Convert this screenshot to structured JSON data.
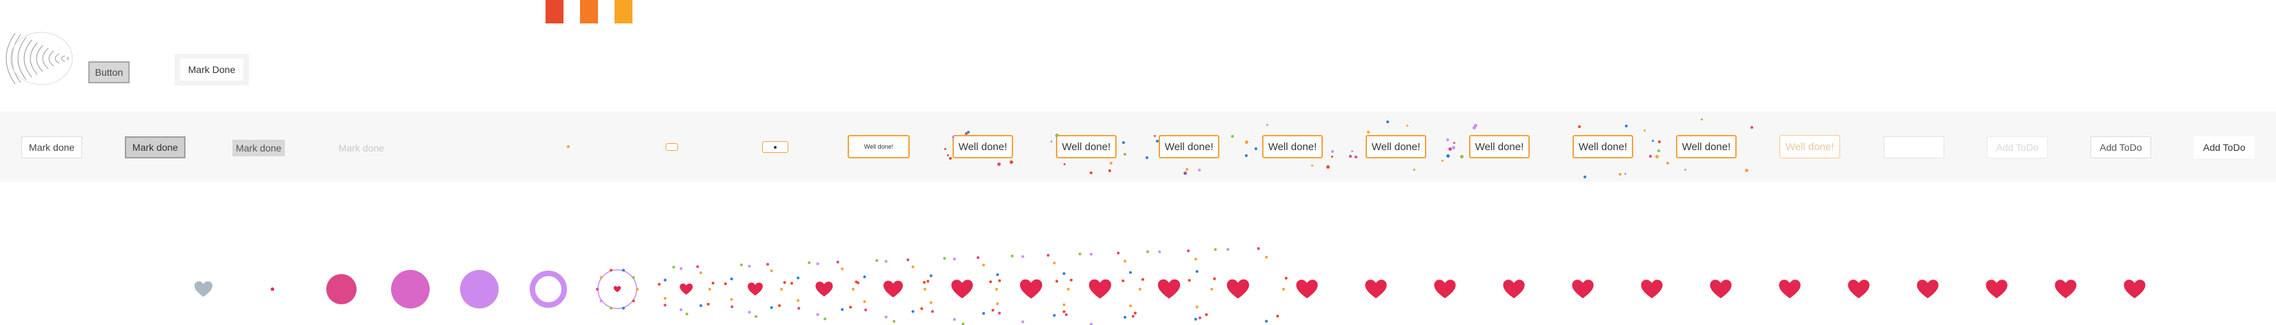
{
  "colors": {
    "swatches": [
      "#e64a2b",
      "#f47a24",
      "#f8a526"
    ],
    "heart_red": "#e2264d",
    "heart_grey": "#aab8c2",
    "circle_pink": "#dd4688",
    "circle_magenta": "#d867c8",
    "circle_violet": "#cd8aee",
    "ring_violet": "#cc8ef5",
    "orange_border": "#f3a33a"
  },
  "top": {
    "button_label": "Button",
    "mark_done_label": "Mark Done"
  },
  "band": {
    "chips": [
      {
        "label": "Mark done",
        "style": "plain"
      },
      {
        "label": "Mark done",
        "style": "pressed"
      },
      {
        "label": "Mark done",
        "style": "grey"
      },
      {
        "label": "Mark done",
        "style": "ghost"
      },
      {
        "label": "",
        "style": "dot"
      },
      {
        "label": "",
        "style": "tiny"
      },
      {
        "label": "",
        "style": "small"
      },
      {
        "label": "Well done!",
        "style": "orange-small"
      },
      {
        "label": "Well done!",
        "style": "orange"
      },
      {
        "label": "Well done!",
        "style": "orange"
      },
      {
        "label": "Well done!",
        "style": "orange"
      },
      {
        "label": "Well done!",
        "style": "orange"
      },
      {
        "label": "Well done!",
        "style": "orange"
      },
      {
        "label": "Well done!",
        "style": "orange"
      },
      {
        "label": "Well done!",
        "style": "orange"
      },
      {
        "label": "Well done!",
        "style": "orange"
      },
      {
        "label": "Well done!",
        "style": "orange-faded"
      },
      {
        "label": "",
        "style": "empty"
      },
      {
        "label": "Add ToDo",
        "style": "addfaint"
      },
      {
        "label": "Add ToDo",
        "style": "add"
      },
      {
        "label": "Add ToDo",
        "style": "addbold"
      }
    ]
  },
  "hearts": {
    "frames": [
      "grey-heart",
      "red-dot",
      "pink-circle",
      "magenta-circle",
      "violet-circle",
      "violet-ring",
      "burst-ring",
      "burst-heart",
      "burst-heart",
      "burst-heart",
      "burst-heart",
      "burst-heart",
      "burst-heart",
      "burst-heart",
      "burst-heart",
      "burst-heart",
      "heart",
      "heart",
      "heart",
      "heart",
      "heart",
      "heart",
      "heart",
      "heart",
      "heart",
      "heart",
      "heart",
      "heart",
      "heart"
    ]
  }
}
